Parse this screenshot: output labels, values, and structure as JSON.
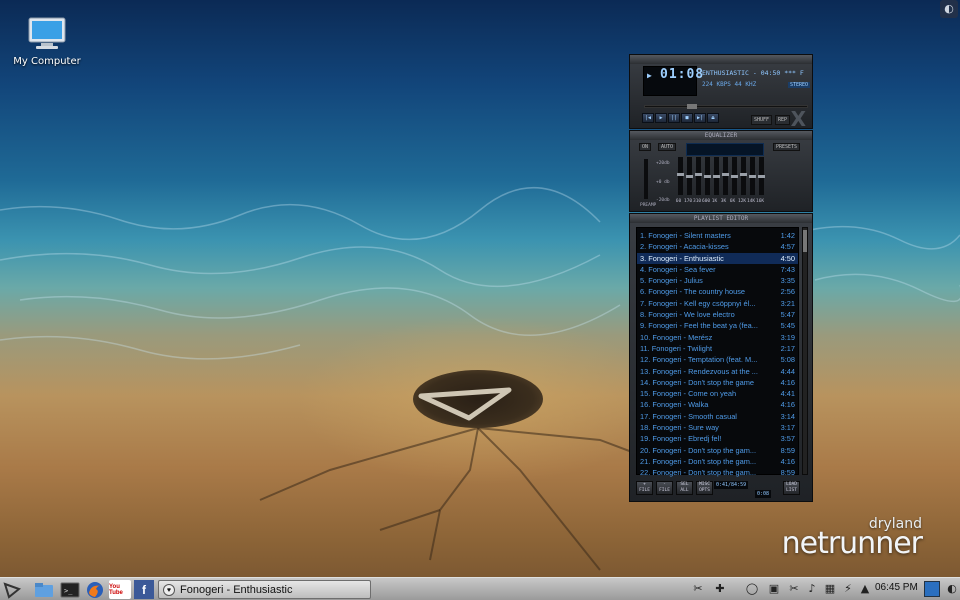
{
  "desktop": {
    "icons": [
      {
        "label": "My Computer",
        "icon": "computer-icon"
      }
    ],
    "branding": {
      "small": "dryland",
      "large": "netrunner"
    }
  },
  "player": {
    "time": "01:08",
    "marquee": "ENTHUSIASTIC - 04:50",
    "marquee_suffix": "*** F",
    "bitrate": "224",
    "kbps_label": "KBPS",
    "samplerate": "44",
    "khz_label": "KHZ",
    "stereo": "STEREO",
    "shuffle_label": "SHUFF",
    "repeat_label": "REP",
    "controls": [
      "|◀",
      "▶",
      "||",
      "■",
      "▶|",
      "⏏"
    ],
    "equalizer": {
      "title": "EQUALIZER",
      "on": "ON",
      "auto": "AUTO",
      "presets": "PRESETS",
      "scale_top": "+20db",
      "scale_mid": "+0 db",
      "scale_bot": "-20db",
      "preamp": "PREAMP",
      "bands": [
        {
          "freq": "60",
          "level": 0.55
        },
        {
          "freq": "170",
          "level": 0.5
        },
        {
          "freq": "310",
          "level": 0.55
        },
        {
          "freq": "600",
          "level": 0.5
        },
        {
          "freq": "1K",
          "level": 0.5
        },
        {
          "freq": "3K",
          "level": 0.55
        },
        {
          "freq": "6K",
          "level": 0.5
        },
        {
          "freq": "12K",
          "level": 0.55
        },
        {
          "freq": "14K",
          "level": 0.5
        },
        {
          "freq": "16K",
          "level": 0.5
        }
      ]
    },
    "playlist": {
      "title": "PLAYLIST EDITOR",
      "active_index": 2,
      "tracks": [
        {
          "title": "1. Fonogeri - Silent masters",
          "length": "1:42"
        },
        {
          "title": "2. Fonogeri - Acacia-kisses",
          "length": "4:57"
        },
        {
          "title": "3. Fonogeri - Enthusiastic",
          "length": "4:50"
        },
        {
          "title": "4. Fonogeri - Sea fever",
          "length": "7:43"
        },
        {
          "title": "5. Fonogeri - Julius",
          "length": "3:35"
        },
        {
          "title": "6. Fonogeri - The country house",
          "length": "2:56"
        },
        {
          "title": "7. Fonogeri - Kell egy csöppnyi él...",
          "length": "3:21"
        },
        {
          "title": "8. Fonogeri - We love electro",
          "length": "5:47"
        },
        {
          "title": "9. Fonogeri - Feel the beat ya (fea...",
          "length": "5:45"
        },
        {
          "title": "10. Fonogeri - Merész",
          "length": "3:19"
        },
        {
          "title": "11. Fonogeri - Twilight",
          "length": "2:17"
        },
        {
          "title": "12. Fonogeri - Temptation (feat. M...",
          "length": "5:08"
        },
        {
          "title": "13. Fonogeri - Rendezvous at the ...",
          "length": "4:44"
        },
        {
          "title": "14. Fonogeri - Don't stop the game",
          "length": "4:16"
        },
        {
          "title": "15. Fonogeri - Come on yeah",
          "length": "4:41"
        },
        {
          "title": "16. Fonogeri - Walka",
          "length": "4:16"
        },
        {
          "title": "17. Fonogeri - Smooth casual",
          "length": "3:14"
        },
        {
          "title": "18. Fonogeri - Sure way",
          "length": "3:17"
        },
        {
          "title": "19. Fonogeri - Ebredj fel!",
          "length": "3:57"
        },
        {
          "title": "20. Fonogeri - Don't stop the gam...",
          "length": "8:59"
        },
        {
          "title": "21. Fonogeri - Don't stop the gam...",
          "length": "4:16"
        },
        {
          "title": "22. Fonogeri - Don't stop the gam...",
          "length": "8:59"
        }
      ],
      "buttons": [
        "+ FILE",
        "- FILE",
        "SEL ALL",
        "MISC OPTS"
      ],
      "list_btn": "LOAD LIST",
      "info": "0:41/84:59",
      "info2": "0:08"
    }
  },
  "taskbar": {
    "task_title": "Fonogeri - Enthusiastic",
    "clock": "06:45 PM",
    "launchers": [
      "kickoff-icon",
      "home-folder-icon",
      "terminal-icon",
      "firefox-icon",
      "youtube-icon",
      "facebook-icon"
    ],
    "youtube_label": "You Tube",
    "facebook_label": "f"
  }
}
